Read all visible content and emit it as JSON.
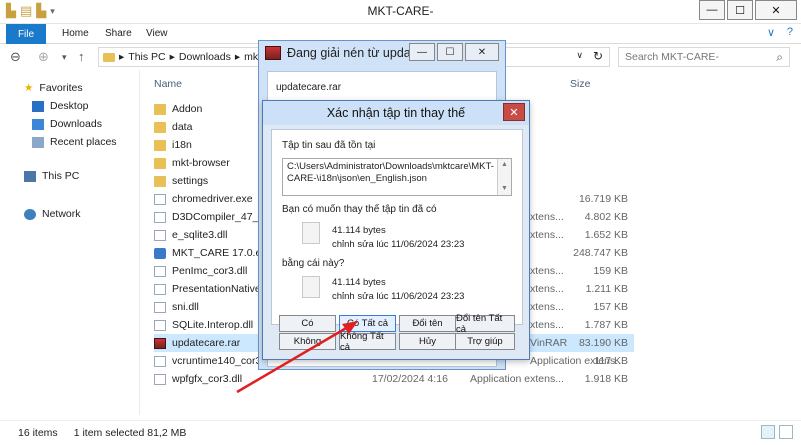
{
  "window": {
    "title": "MKT-CARE-",
    "min": "—",
    "max": "☐",
    "close": "✕"
  },
  "ribbon": {
    "file": "File",
    "home": "Home",
    "share": "Share",
    "view": "View",
    "help_chevron": "∨",
    "help": "?"
  },
  "address": {
    "segments": [
      "This PC",
      "Downloads",
      "mk"
    ],
    "search_placeholder": "Search MKT-CARE-"
  },
  "nav": {
    "favorites": "Favorites",
    "desktop": "Desktop",
    "downloads": "Downloads",
    "recent": "Recent places",
    "thispc": "This PC",
    "network": "Network"
  },
  "columns": {
    "name": "Name",
    "size": "Size"
  },
  "files": [
    {
      "name": "Addon",
      "type": "",
      "size": "",
      "kind": "folder"
    },
    {
      "name": "data",
      "type": "",
      "size": "",
      "kind": "folder"
    },
    {
      "name": "i18n",
      "type": "",
      "size": "",
      "kind": "folder"
    },
    {
      "name": "mkt-browser",
      "type": "",
      "size": "",
      "kind": "folder"
    },
    {
      "name": "settings",
      "type": "",
      "size": "",
      "kind": "folder"
    },
    {
      "name": "chromedriver.exe",
      "type": "",
      "size": "16.719 KB",
      "kind": "file"
    },
    {
      "name": "D3DCompiler_47_c",
      "type": "xtens...",
      "size": "4.802 KB",
      "kind": "file"
    },
    {
      "name": "e_sqlite3.dll",
      "type": "xtens...",
      "size": "1.652 KB",
      "kind": "file"
    },
    {
      "name": "MKT_CARE 17.0.exe",
      "type": "",
      "size": "248.747 KB",
      "kind": "exe"
    },
    {
      "name": "PenImc_cor3.dll",
      "type": "xtens...",
      "size": "159 KB",
      "kind": "file"
    },
    {
      "name": "PresentationNative_",
      "type": "xtens...",
      "size": "1.211 KB",
      "kind": "file"
    },
    {
      "name": "sni.dll",
      "type": "xtens...",
      "size": "157 KB",
      "kind": "file"
    },
    {
      "name": "SQLite.Interop.dll",
      "type": "xtens...",
      "size": "1.787 KB",
      "kind": "file"
    },
    {
      "name": "updatecare.rar",
      "type": "VinRAR",
      "size": "83.190 KB",
      "kind": "rar"
    },
    {
      "name": "vcruntime140_cor3.dll",
      "date": "",
      "type": "Application extens...",
      "size": "117 KB",
      "kind": "file"
    },
    {
      "name": "wpfgfx_cor3.dll",
      "date": "17/02/2024 4:16",
      "type": "Application extens...",
      "size": "1.918 KB",
      "kind": "file"
    }
  ],
  "status": {
    "count": "16 items",
    "selected": "1 item selected  81,2 MB"
  },
  "rar_dialog": {
    "title": "Đang giải nén từ upda...",
    "archive": "updatecare.rar"
  },
  "confirm": {
    "title": "Xác nhận tập tin thay thế",
    "exists_label": "Tập tin sau đã tồn tại",
    "path": "C:\\Users\\Administrator\\Downloads\\mktcare\\MKT-CARE-\\i18n\\json\\en_English.json",
    "question": "Bạn có muốn thay thế tập tin đã có",
    "old_size": "41.114 bytes",
    "old_modified": "chỉnh sửa lúc 11/06/2024 23:23",
    "with_label": "bằng cái này?",
    "new_size": "41.114 bytes",
    "new_modified": "chỉnh sửa lúc 11/06/2024 23:23",
    "buttons": {
      "yes": "Có",
      "yes_all": "Có Tất cả",
      "rename": "Đổi tên",
      "rename_all": "Đổi tên Tất cả",
      "no": "Không",
      "no_all": "Không Tất cả",
      "cancel": "Hủy",
      "help": "Trợ giúp"
    }
  },
  "colors": {
    "accent": "#1979ca",
    "arrow": "#e02020",
    "close_red": "#c74b47"
  }
}
